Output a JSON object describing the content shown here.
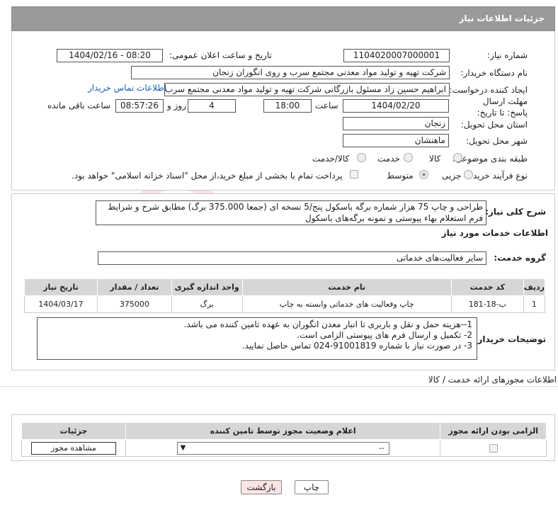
{
  "header": {
    "title": "جزئیات اطلاعات نیاز"
  },
  "form": {
    "need_number_label": "شماره نیاز:",
    "need_number": "1104020007000001",
    "announce_label": "تاریخ و ساعت اعلان عمومی:",
    "announce_value": "1404/02/16 - 08:20",
    "buyer_label": "نام دستگاه خریدار:",
    "buyer_value": "شرکت تهیه و تولید مواد معدنی مجتمع سرب و روی انگوران   زنجان",
    "creator_label": "ایجاد کننده درخواست:",
    "creator_value": "ابراهیم حسین زاد مسئول بازرگانی شرکت تهیه و تولید مواد معدنی مجتمع سرب",
    "contact_link": "اطلاعات تماس خریدار",
    "deadline_label": "مهلت ارسال پاسخ: تا تاریخ:",
    "deadline_date": "1404/02/20",
    "time_label": "ساعت",
    "deadline_time": "18:00",
    "days_value": "4",
    "days_label": "روز و",
    "remaining_value": "08:57:26",
    "remaining_label": "ساعت باقی مانده",
    "province_label": "استان محل تحویل:",
    "province_value": "زنجان",
    "city_label": "شهر محل تحویل:",
    "city_value": "ماهنشان",
    "category_label": "طبقه بندی موضوعی:",
    "category_options": [
      "کالا",
      "خدمت",
      "کالا/خدمت"
    ],
    "process_label": "نوع فرآیند خرید :",
    "process_options": [
      "جزیی",
      "متوسط"
    ],
    "payment_note": "پرداخت تمام یا بخشی از مبلغ خرید،از محل \"اسناد خزانه اسلامی\" خواهد بود."
  },
  "description": {
    "label": "شرح کلی نیاز:",
    "text": "طراحی و چاپ 75 هزار شماره برگه باسکول پنج/5 نسخه ای (جمعا 375.000 برگ) مطابق شرح و شرایط فرم استعلام بهاء پیوستی و نمونه برگه‌های باسکول"
  },
  "services": {
    "section_title": "اطلاعات خدمات مورد نیاز",
    "group_label": "گروه خدمت:",
    "group_value": "سایر فعالیت‌های خدماتی",
    "columns": [
      "ردیف",
      "کد خدمت",
      "نام خدمت",
      "واحد اندازه گیری",
      "تعداد / مقدار",
      "تاریخ نیاز"
    ],
    "rows": [
      [
        "1",
        "ب-18-181",
        "چاپ وفعالیت های خدماتی وابسته به چاپ",
        "برگ",
        "375000",
        "1404/03/17"
      ]
    ]
  },
  "buyer_notes": {
    "label": "توضیحات خریدار:",
    "lines": [
      "1--هزینه حمل و نقل و باربری تا انبار معدن انگوران به عهده تامین کننده می باشد.",
      "2- تکمیل و ارسال فرم های پیوستی الزامی است.",
      "3- در صورت نیاز با شماره 91001819-024 تماس حاصل نمایید."
    ]
  },
  "permits": {
    "section_title": "اطلاعات مجوزهای ارائه خدمت / کالا",
    "columns": [
      "الزامی بودن ارائه مجوز",
      "اعلام وضعیت مجوز توسط تامین کننده",
      "جزئیات"
    ],
    "select_value": "--",
    "view_button": "مشاهده مجوز"
  },
  "footer": {
    "print_button": "چاپ",
    "back_button": "بازگشت"
  },
  "watermark": {
    "text": "AriaTender.neT"
  }
}
